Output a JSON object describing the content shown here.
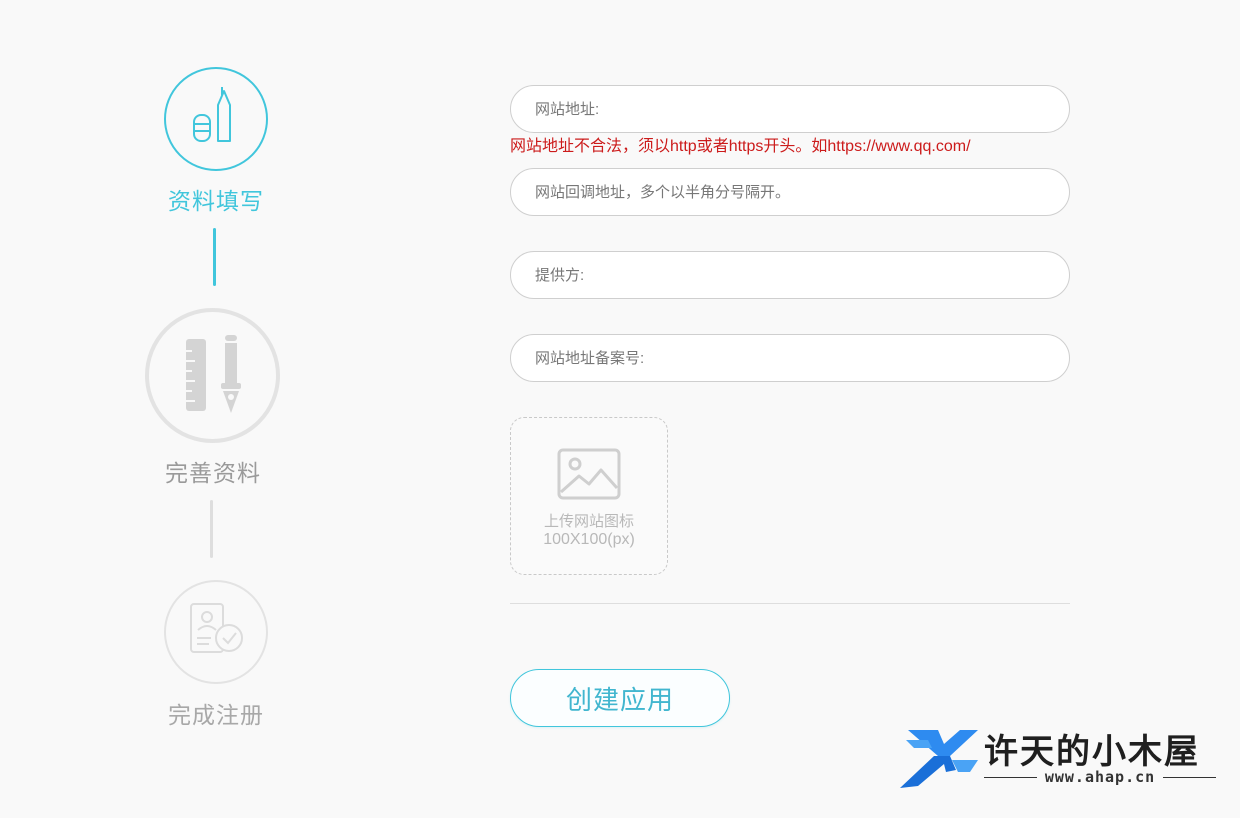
{
  "steps": [
    {
      "label": "资料填写",
      "state": "active",
      "icon": "pencil-eraser-icon"
    },
    {
      "label": "完善资料",
      "state": "inactive",
      "icon": "ruler-pen-icon"
    },
    {
      "label": "完成注册",
      "state": "inactive",
      "icon": "document-check-icon"
    }
  ],
  "form": {
    "website_url": {
      "placeholder": "网站地址:",
      "value": ""
    },
    "error": "网站地址不合法，须以http或者https开头。如https://www.qq.com/",
    "callback_url": {
      "placeholder": "网站回调地址，多个以半角分号隔开。",
      "value": ""
    },
    "provider": {
      "placeholder": "提供方:",
      "value": ""
    },
    "icp_number": {
      "placeholder": "网站地址备案号:",
      "value": ""
    },
    "upload": {
      "label": "上传网站图标",
      "size": "100X100(px)",
      "icon": "image-placeholder-icon"
    },
    "submit_label": "创建应用"
  },
  "watermark": {
    "title": "许天的小木屋",
    "url": "www.ahap.cn"
  },
  "colors": {
    "accent": "#41c6dc",
    "error": "#cc1b1b",
    "inactive": "#d4d4d4",
    "background": "#f9f9f9"
  }
}
